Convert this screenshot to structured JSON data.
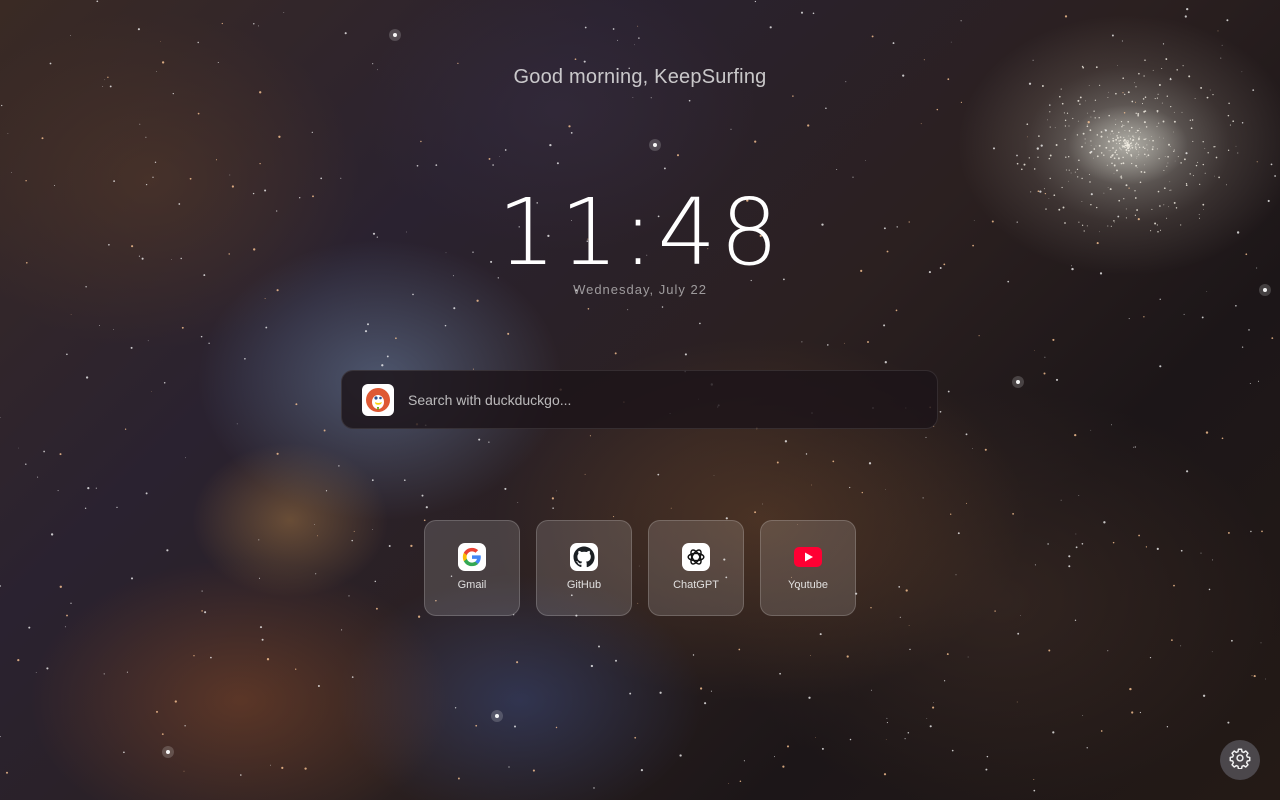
{
  "greeting": "Good morning, KeepSurfing",
  "clock": {
    "time": "11:48",
    "date": "Wednesday, July 22"
  },
  "search": {
    "engine_icon": "duckduckgo-icon",
    "placeholder": "Search with duckduckgo..."
  },
  "shortcuts": [
    {
      "label": "Gmail",
      "icon": "google-icon"
    },
    {
      "label": "GitHub",
      "icon": "github-icon"
    },
    {
      "label": "ChatGPT",
      "icon": "chatgpt-icon"
    },
    {
      "label": "Youtube",
      "icon": "youtube-icon"
    }
  ],
  "settings_icon": "gear-icon",
  "colors": {
    "duckduckgo": "#de5833",
    "youtube": "#ff0033",
    "github": "#1b1f23"
  }
}
